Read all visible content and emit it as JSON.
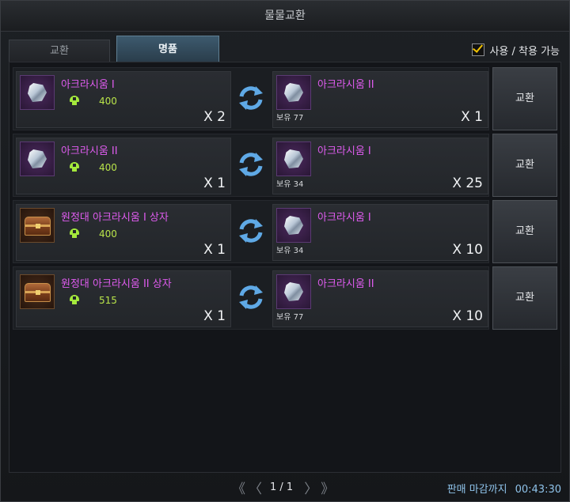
{
  "window": {
    "title": "물물교환"
  },
  "tabs": [
    {
      "label": "교환",
      "active": false
    },
    {
      "label": "명품",
      "active": true
    }
  ],
  "filter": {
    "label": "사용 / 착용 가능",
    "checked": true
  },
  "exchange_rows": [
    {
      "cost_item": {
        "name": "아크라시움 I",
        "icon": "acrasium-crystal-icon",
        "cost": "400",
        "qty": "X 2"
      },
      "reward_item": {
        "name": "아크라시움 II",
        "icon": "acrasium-crystal-icon",
        "owned": "보유 77",
        "qty": "X 1"
      },
      "button": "교환"
    },
    {
      "cost_item": {
        "name": "아크라시움 II",
        "icon": "acrasium-crystal-icon",
        "cost": "400",
        "qty": "X 1"
      },
      "reward_item": {
        "name": "아크라시움 I",
        "icon": "acrasium-crystal-icon",
        "owned": "보유 34",
        "qty": "X 25"
      },
      "button": "교환"
    },
    {
      "cost_item": {
        "name": "원정대 아크라시움 I 상자",
        "icon": "treasure-chest-icon",
        "cost": "400",
        "qty": "X 1"
      },
      "reward_item": {
        "name": "아크라시움 I",
        "icon": "acrasium-crystal-icon",
        "owned": "보유 34",
        "qty": "X 10"
      },
      "button": "교환"
    },
    {
      "cost_item": {
        "name": "원정대 아크라시움  II  상자",
        "icon": "treasure-chest-icon",
        "cost": "515",
        "qty": "X 1"
      },
      "reward_item": {
        "name": "아크라시움 II",
        "icon": "acrasium-crystal-icon",
        "owned": "보유 77",
        "qty": "X 10"
      },
      "button": "교환"
    }
  ],
  "pagination": {
    "label": "1 / 1"
  },
  "deadline": {
    "label": "판매 마감까지",
    "time": "00:43:30"
  },
  "colors": {
    "item_name": "#e05cf0",
    "cost_value": "#b9e44a",
    "deadline": "#8fc3ea",
    "check": "#f3c400"
  }
}
